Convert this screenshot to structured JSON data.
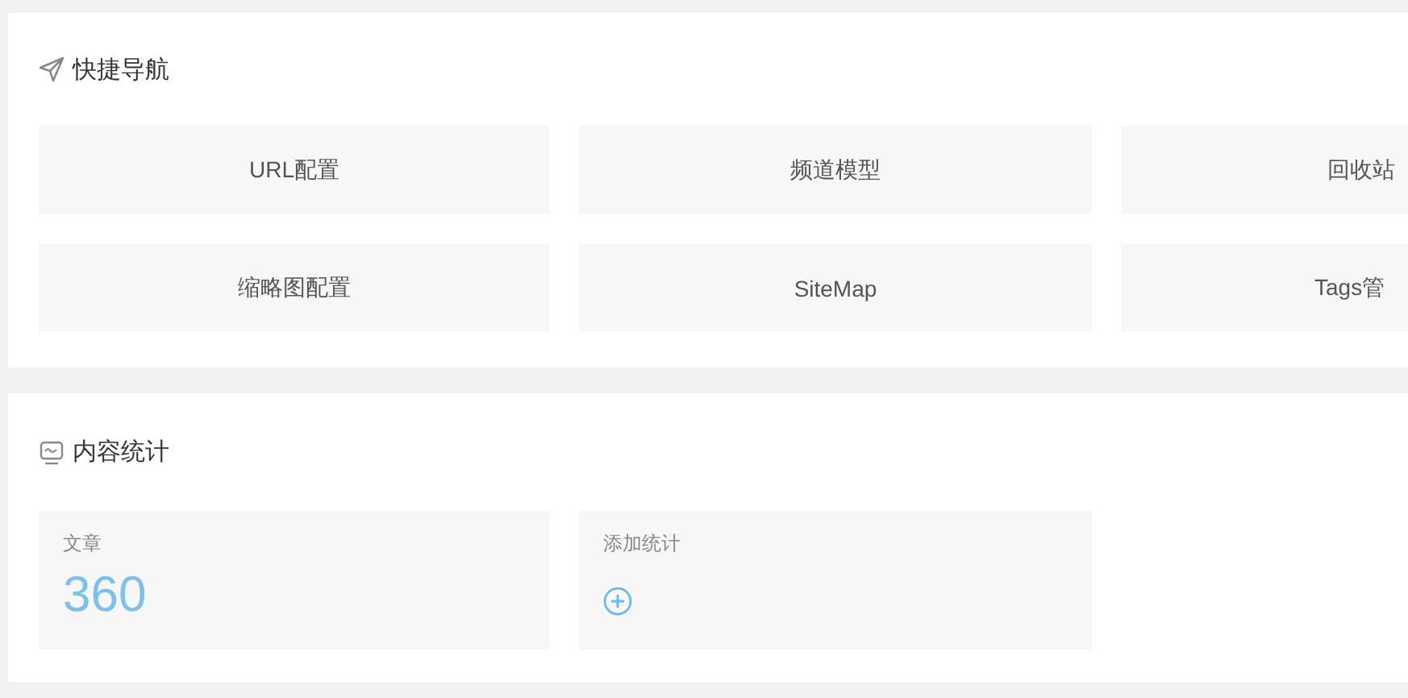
{
  "quick_nav": {
    "title": "快捷导航",
    "items": [
      {
        "label": "URL配置"
      },
      {
        "label": "频道模型"
      },
      {
        "label": "回收站"
      },
      {
        "label": "缩略图配置"
      },
      {
        "label": "SiteMap"
      },
      {
        "label": "Tags管"
      }
    ]
  },
  "content_stats": {
    "title": "内容统计",
    "cards": [
      {
        "kind": "count",
        "label": "文章",
        "value": "360"
      },
      {
        "kind": "add",
        "label": "添加统计"
      }
    ]
  }
}
